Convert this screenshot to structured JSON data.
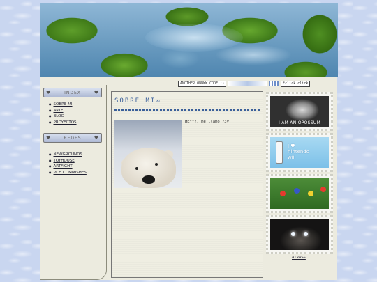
{
  "ticker": {
    "box1": "ANOTHER OWWWW CODE :)",
    "box2": "*click click"
  },
  "sidebar": {
    "index_header": "INDEX",
    "index_items": [
      "SOBRE MI",
      "ARTE",
      "BLOG",
      "PROYECTOS"
    ],
    "redes_header": "REDES",
    "redes_items": [
      "NEWGROUNDS",
      "TOYHOUSE",
      "ARTFIGHT",
      "VCH COMMISHES"
    ]
  },
  "main": {
    "title": "SOBRE MI✉",
    "intro": "HEYYY, me llamo 73y."
  },
  "stamps": {
    "opossum_caption": "I AM AN OPOSSUM",
    "wii_line1": "I ♥",
    "wii_line2": "nintendo",
    "wii_line3": "wii"
  },
  "footer": {
    "back_link": "ATRAS⇨"
  },
  "colors": {
    "page_bg": "#c9d6f0",
    "content_bg": "#ecebdf",
    "accent": "#3a5f9a"
  }
}
